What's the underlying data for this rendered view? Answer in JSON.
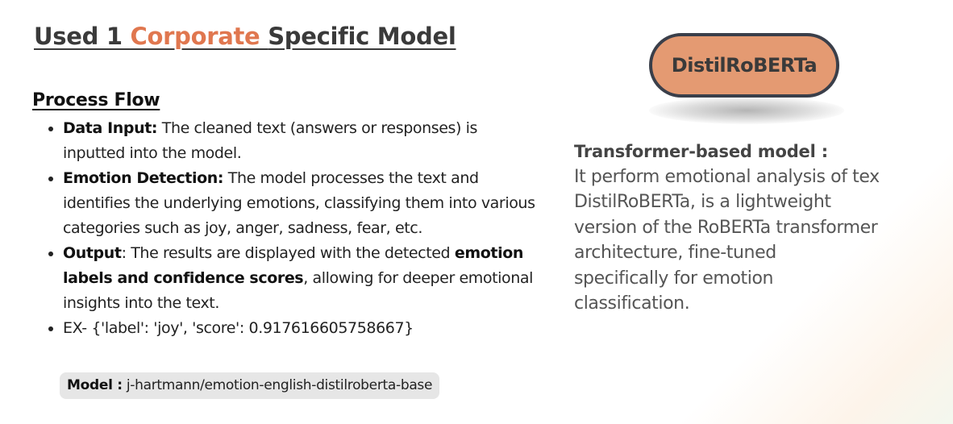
{
  "title": {
    "part1": "Used 1 ",
    "accent": "Corporate ",
    "part2": "Specific Model"
  },
  "process": {
    "heading": "Process Flow",
    "items": [
      {
        "bold": "Data Input:",
        "text": " The cleaned text (answers or responses) is inputted into the model."
      },
      {
        "bold": "Emotion Detection:",
        "text": " The model processes the text and identifies the underlying emotions, classifying them into various categories such as joy, anger, sadness, fear, etc."
      },
      {
        "bold": "Output",
        "text1": ": The results are displayed with the detected ",
        "bold2": "emotion labels and confidence scores",
        "text2": ", allowing for deeper emotional insights into the text."
      },
      {
        "text": "EX- {'label': 'joy', 'score': 0.917616605758667}"
      }
    ]
  },
  "model": {
    "label": "Model :",
    "value": " j-hartmann/emotion-english-distilroberta-base"
  },
  "badge": {
    "label": "DistilRoBERTa",
    "fill_color": "#e49a72",
    "border_color": "#3a3f4a"
  },
  "description": {
    "heading": "Transformer-based model :",
    "lines": [
      "It perform emotional analysis of tex",
      "DistilRoBERTa, is a lightweight",
      "version of the RoBERTa transformer",
      "architecture, fine-tuned",
      "specifically for emotion",
      "classification."
    ]
  },
  "colors": {
    "accent": "#e0774f"
  }
}
